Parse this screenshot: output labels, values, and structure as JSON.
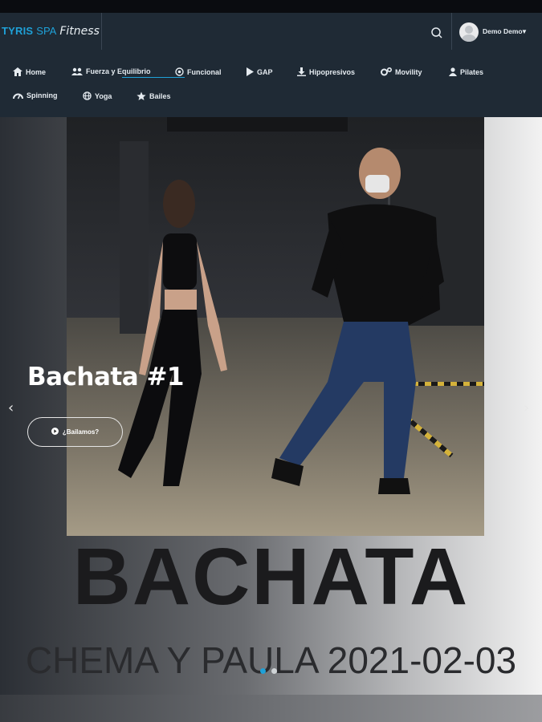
{
  "brand": {
    "part1": "TYRIS",
    "part2": "SPA",
    "part3": "Fitness"
  },
  "header": {
    "user_name": "Demo Demo"
  },
  "nav": {
    "items": [
      {
        "label": "Home",
        "icon": "home-icon"
      },
      {
        "label": "Fuerza y Equilibrio",
        "icon": "users-icon"
      },
      {
        "label": "Funcional",
        "icon": "target-icon"
      },
      {
        "label": "GAP",
        "icon": "play-icon"
      },
      {
        "label": "Hipopresivos",
        "icon": "download-icon"
      },
      {
        "label": "Movility",
        "icon": "gears-icon"
      },
      {
        "label": "Pilates",
        "icon": "user-icon"
      },
      {
        "label": "Spinning",
        "icon": "gauge-icon"
      },
      {
        "label": "Yoga",
        "icon": "globe-icon"
      },
      {
        "label": "Bailes",
        "icon": "star-icon"
      }
    ]
  },
  "hero": {
    "title": "Bachata #1",
    "cta_label": "¿Bailamos?",
    "big_title": "BACHATA",
    "subtitle": "CHEMA Y PAULA 2021-02-03",
    "slide_count": 2,
    "active_slide": 1
  },
  "colors": {
    "accent": "#1fa1d8",
    "header_bg": "#1f2a35"
  }
}
